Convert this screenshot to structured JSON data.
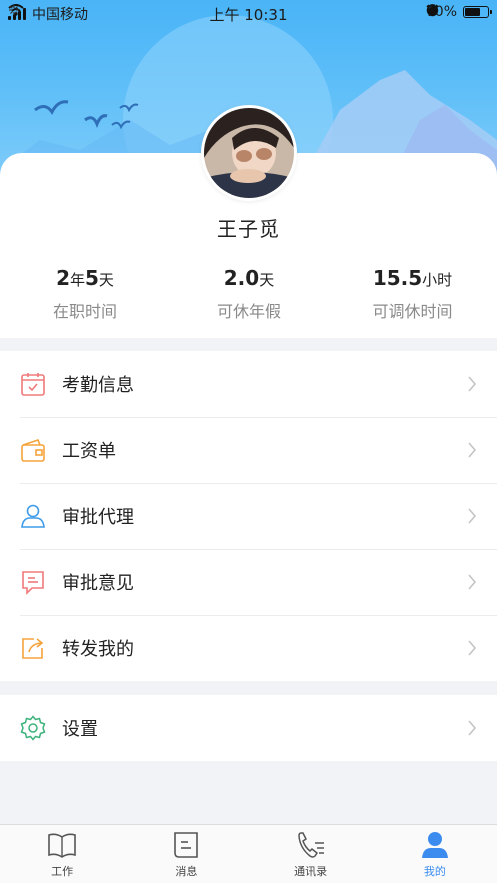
{
  "status_bar": {
    "carrier": "中国移动",
    "time": "上午 10:31",
    "battery": "70%",
    "battery_level": 0.7
  },
  "profile": {
    "name": "王子觅"
  },
  "stats": [
    {
      "v1": "2",
      "u1": "年",
      "v2": "5",
      "u2": "天",
      "label": "在职时间"
    },
    {
      "v1": "2.0",
      "u1": "天",
      "label": "可休年假"
    },
    {
      "v1": "15.5",
      "u1": "小时",
      "label": "可调休时间"
    }
  ],
  "menu": [
    {
      "label": "考勤信息",
      "icon": "calendar-icon",
      "color": "#f07a7a"
    },
    {
      "label": "工资单",
      "icon": "wallet-icon",
      "color": "#f5a33b"
    },
    {
      "label": "审批代理",
      "icon": "user-icon",
      "color": "#3e9be8"
    },
    {
      "label": "审批意见",
      "icon": "comment-icon",
      "color": "#f07a7a"
    },
    {
      "label": "转发我的",
      "icon": "share-icon",
      "color": "#f5a33b"
    }
  ],
  "menu2": [
    {
      "label": "设置",
      "icon": "gear-icon",
      "color": "#3db27a"
    }
  ],
  "tabs": [
    {
      "label": "工作",
      "icon": "book-icon",
      "active": false
    },
    {
      "label": "消息",
      "icon": "message-icon",
      "active": false
    },
    {
      "label": "通讯录",
      "icon": "phone-book-icon",
      "active": false
    },
    {
      "label": "我的",
      "icon": "person-icon",
      "active": true
    }
  ],
  "colors": {
    "accent": "#3c8cf0",
    "header": "#49b4f7",
    "tab_inactive": "#444444"
  }
}
